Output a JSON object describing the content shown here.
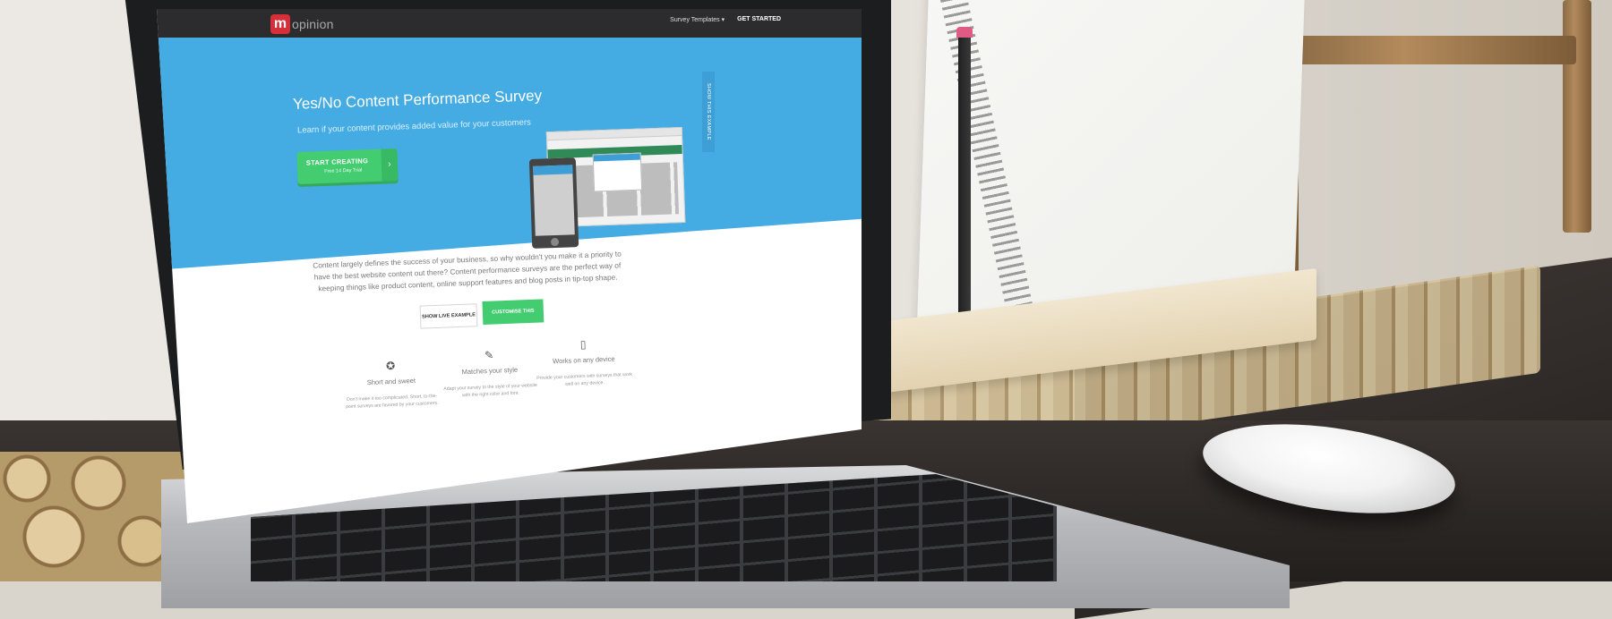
{
  "site": {
    "logo_mark": "m",
    "logo_text": "opinion",
    "nav": {
      "templates": "Survey Templates ▾",
      "get_started": "GET STARTED"
    }
  },
  "hero": {
    "title": "Yes/No Content Performance Survey",
    "subtitle": "Learn if your content provides added value for your customers",
    "cta_label": "START CREATING",
    "cta_sub": "Free 14 Day Trial",
    "side_tab": "SHOW THIS EXAMPLE"
  },
  "intro": {
    "text": "Content largely defines the success of your business, so why wouldn't you make it a priority to have the best website content out there? Content performance surveys are the perfect way of keeping things like product content, online support features and blog posts in tip-top shape.",
    "btn_live": "SHOW LIVE EXAMPLE",
    "btn_customise": "CUSTOMISE THIS SURVEY"
  },
  "features": [
    {
      "icon": "award-icon",
      "title": "Short and sweet",
      "desc": "Don't make it too complicated. Short, to-the-point surveys are favored by your customers."
    },
    {
      "icon": "pencil-icon",
      "title": "Matches your style",
      "desc": "Adapt your survey to the style of your website with the right color and font."
    },
    {
      "icon": "mobile-icon",
      "title": "Works on any device",
      "desc": "Provide your customers with surveys that work well on any device."
    }
  ],
  "colors": {
    "hero_blue": "#45ace3",
    "cta_green": "#44cc71",
    "brand_red": "#d62f3a"
  }
}
